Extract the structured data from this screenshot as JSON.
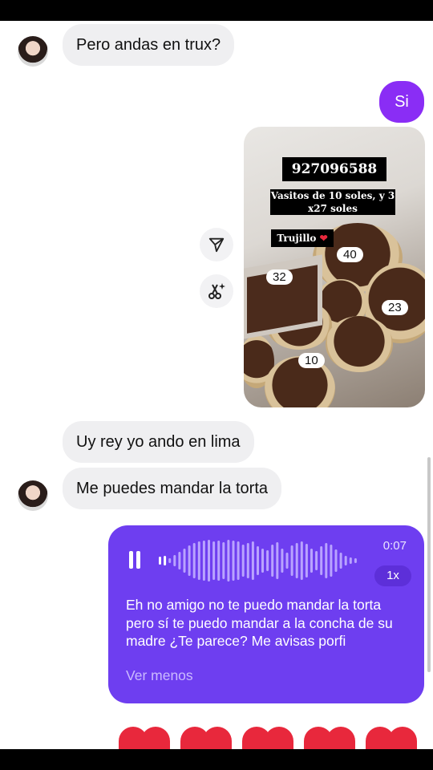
{
  "messages": {
    "m1": "Pero andas en trux?",
    "m2": "Si",
    "m3": "Uy rey yo ando en lima",
    "m4": "Me puedes mandar la torta"
  },
  "photo": {
    "phone": "927096588",
    "offer": "Vasitos de 10 soles, y 3 x27 soles",
    "city": "Trujillo",
    "labels": [
      "40",
      "32",
      "23",
      "10"
    ]
  },
  "voice_note": {
    "duration": "0:07",
    "speed": "1x",
    "transcript": "Eh no amigo no te puedo mandar la torta pero sí te puedo mandar a la concha de su madre ¿Te parece? Me avisas porfi",
    "toggle": "Ver menos"
  },
  "icons": {
    "share": "share-icon",
    "ai": "ai-sparkle-icon",
    "pause": "pause-icon"
  },
  "colors": {
    "outgoing": "#8a2df5",
    "voice_bg": "#6e3ef0",
    "incoming": "#efeff1",
    "reaction": "#e8283c"
  }
}
